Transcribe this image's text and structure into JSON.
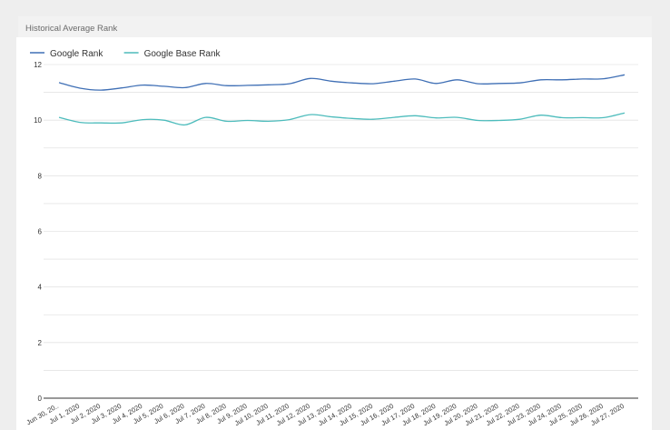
{
  "panel": {
    "title": "Historical Average Rank"
  },
  "colors": {
    "google_rank": "#3f6fb5",
    "google_base_rank": "#4dbcbc",
    "grid": "#e4e4e4",
    "axis": "#333333"
  },
  "chart_data": {
    "type": "line",
    "title": "",
    "xlabel": "",
    "ylabel": "",
    "ylim": [
      0,
      12
    ],
    "yticks": [
      0,
      2,
      4,
      6,
      8,
      10,
      12
    ],
    "grid": true,
    "legend_position": "top-left",
    "categories": [
      "Jun 30, 20..",
      "Jul 1, 2020",
      "Jul 2, 2020",
      "Jul 3, 2020",
      "Jul 4, 2020",
      "Jul 5, 2020",
      "Jul 6, 2020",
      "Jul 7, 2020",
      "Jul 8, 2020",
      "Jul 9, 2020",
      "Jul 10, 2020",
      "Jul 11, 2020",
      "Jul 12, 2020",
      "Jul 13, 2020",
      "Jul 14, 2020",
      "Jul 15, 2020",
      "Jul 16, 2020",
      "Jul 17, 2020",
      "Jul 18, 2020",
      "Jul 19, 2020",
      "Jul 20, 2020",
      "Jul 21, 2020",
      "Jul 22, 2020",
      "Jul 23, 2020",
      "Jul 24, 2020",
      "Jul 25, 2020",
      "Jul 26, 2020",
      "Jul 27, 2020"
    ],
    "series": [
      {
        "name": "Google Rank",
        "values": [
          11.35,
          11.15,
          11.08,
          11.16,
          11.26,
          11.22,
          11.17,
          11.32,
          11.24,
          11.25,
          11.27,
          11.31,
          11.5,
          11.4,
          11.34,
          11.31,
          11.4,
          11.48,
          11.32,
          11.45,
          11.31,
          11.32,
          11.34,
          11.45,
          11.45,
          11.48,
          11.49,
          11.63
        ]
      },
      {
        "name": "Google Base Rank",
        "values": [
          10.1,
          9.92,
          9.9,
          9.9,
          10.02,
          10.0,
          9.83,
          10.1,
          9.96,
          9.99,
          9.96,
          10.02,
          10.2,
          10.12,
          10.06,
          10.03,
          10.1,
          10.16,
          10.08,
          10.1,
          9.99,
          9.99,
          10.03,
          10.18,
          10.09,
          10.09,
          10.09,
          10.26
        ]
      }
    ]
  }
}
